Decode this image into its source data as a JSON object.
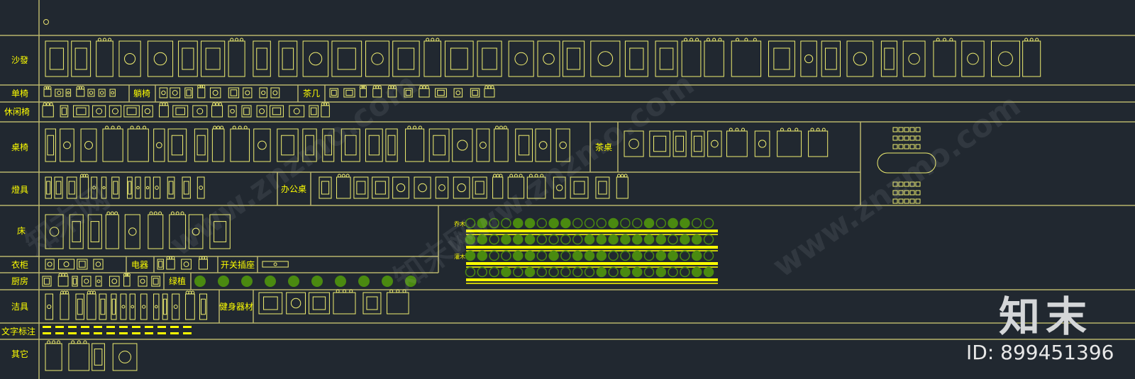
{
  "colors": {
    "background": "#212830",
    "grid_line": "#b8b46a",
    "block": "#f0ee70",
    "label": "#ffff00",
    "plant": "#4a8a10",
    "plant_bar": "#ffff00",
    "watermark": "#c8cdd2",
    "logo": "#d4d6d8"
  },
  "categories": {
    "sofa": "沙發",
    "single_chair": "单椅",
    "recliner": "躺椅",
    "tea_table": "茶几",
    "leisure_chair": "休闲椅",
    "dining": "桌椅",
    "tea_desk": "茶桌",
    "lamps": "燈具",
    "office_desk": "办公桌",
    "bed": "床",
    "wardrobe": "衣柜",
    "appliances": "电器",
    "switch_socket": "开关插座",
    "kitchen": "厨房",
    "greenery": "绿植",
    "sanitary": "洁具",
    "fitness": "健身器材",
    "text_notes": "文字标注",
    "others": "其它"
  },
  "plants": {
    "trees": "乔木",
    "shrubs": "灌木"
  },
  "watermark": {
    "site": "www.znzmo.com",
    "brand_cn": "知末网"
  },
  "logo": {
    "text": "知末",
    "id": "ID: 899451396"
  },
  "icons": [
    "snap-point-icon",
    "furniture-block-icon",
    "plant-block-icon"
  ]
}
